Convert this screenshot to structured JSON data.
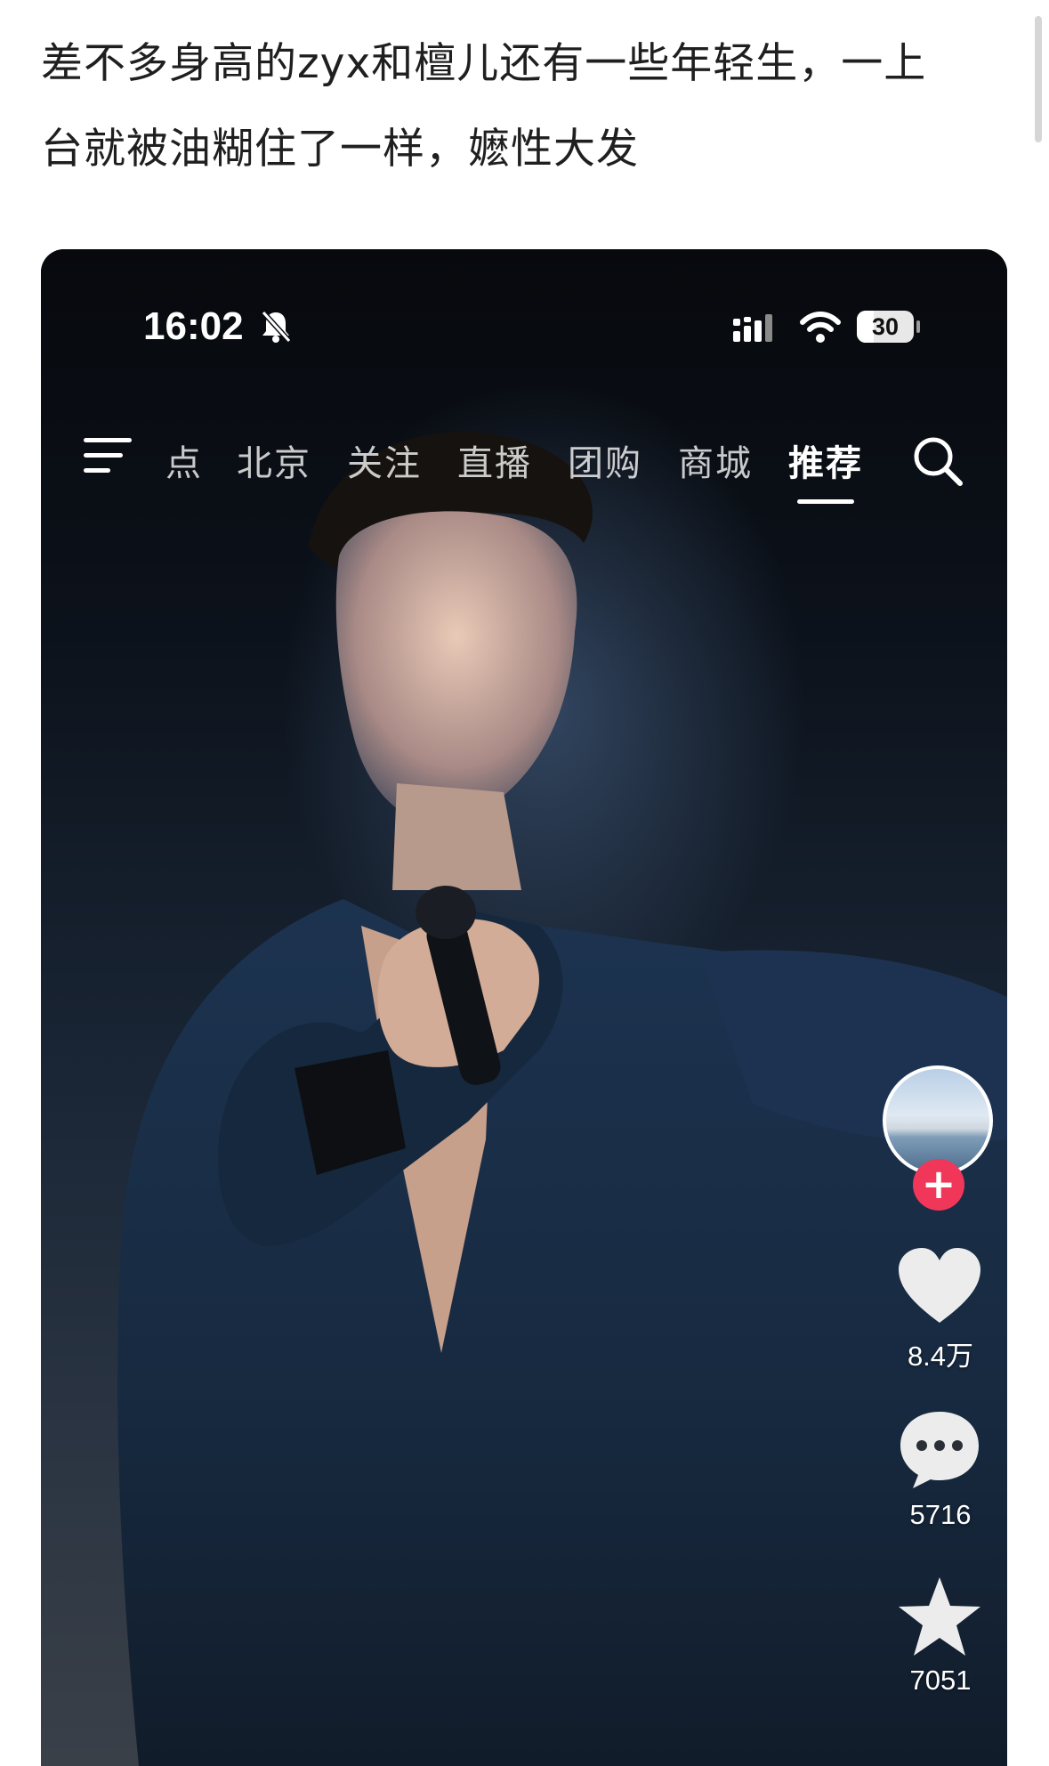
{
  "post": {
    "line1": "差不多身高的zyx和檀儿还有一些年轻生，一上",
    "line2": "台就被油糊住了一样，嬷性大发"
  },
  "phone": {
    "status": {
      "time": "16:02",
      "battery": "30",
      "battery_level": 0.3
    },
    "nav": {
      "tabs": [
        "点",
        "北京",
        "关注",
        "直播",
        "团购",
        "商城",
        "推荐"
      ],
      "active_tab": "推荐"
    },
    "actions": {
      "likes": "8.4万",
      "comments": "5716",
      "favorites": "7051"
    },
    "icons": {
      "menu": "menu-icon",
      "search": "search-icon",
      "like": "heart-icon",
      "comment": "comment-icon",
      "favorite": "star-icon",
      "mute": "bell-muted-icon",
      "signal": "signal-icon",
      "wifi": "wifi-icon"
    },
    "colors": {
      "follow": "#f0375a",
      "active_tab": "#ffffff"
    }
  }
}
